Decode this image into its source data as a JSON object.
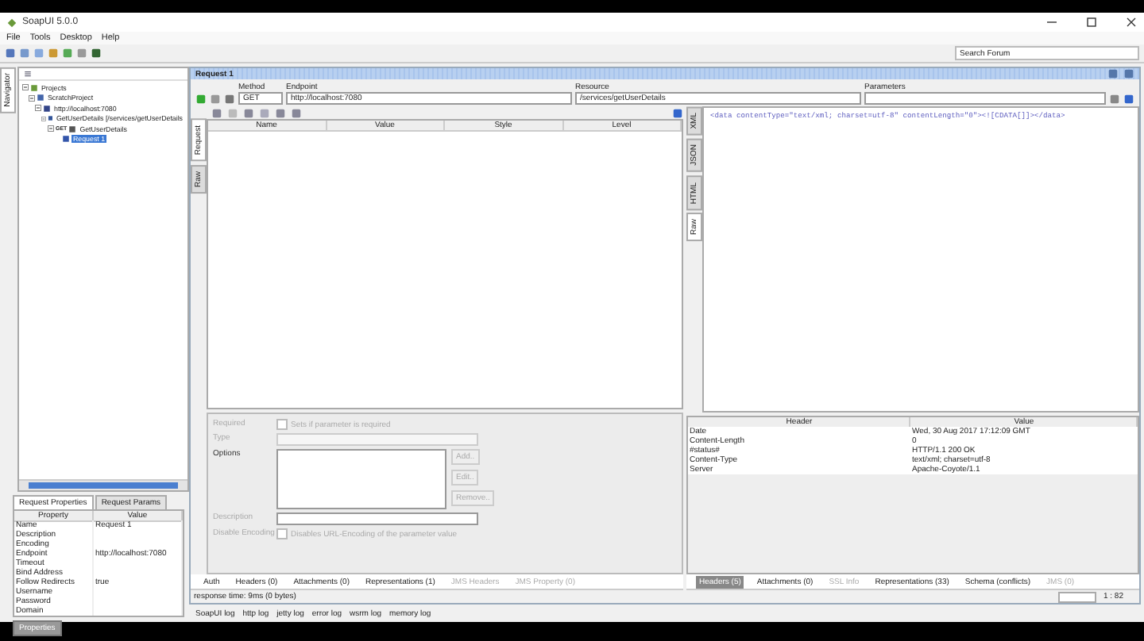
{
  "window": {
    "title": "SoapUI 5.0.0"
  },
  "menu": [
    "File",
    "Tools",
    "Desktop",
    "Help"
  ],
  "search": {
    "placeholder": "Search Forum"
  },
  "navigator": {
    "tab": "Navigator",
    "tree": [
      {
        "label": "Projects",
        "kind": "projects",
        "selected": false,
        "expanded": true,
        "children": [
          {
            "label": "ScratchProject",
            "kind": "project",
            "selected": false,
            "expanded": true,
            "children": [
              {
                "label": "http://localhost:7080",
                "kind": "endpoint",
                "selected": false,
                "expanded": true,
                "children": [
                  {
                    "label": "GetUserDetails [/services/getUserDetails",
                    "kind": "resource",
                    "selected": false,
                    "expanded": true,
                    "children": [
                      {
                        "label": "GetUserDetails",
                        "badge": "GET",
                        "kind": "method",
                        "selected": false,
                        "expanded": true,
                        "children": [
                          {
                            "label": "Request 1",
                            "kind": "request",
                            "selected": true
                          }
                        ]
                      }
                    ]
                  }
                ]
              }
            ]
          }
        ]
      }
    ]
  },
  "properties": {
    "tabs": [
      {
        "label": "Request Properties",
        "selected": true
      },
      {
        "label": "Request Params",
        "selected": false
      }
    ],
    "columns": [
      "Property",
      "Value"
    ],
    "rows": [
      {
        "property": "Name",
        "value": "Request 1"
      },
      {
        "property": "Description"
      },
      {
        "property": "Encoding"
      },
      {
        "property": "Endpoint",
        "value": "http://localhost:7080"
      },
      {
        "property": "Timeout"
      },
      {
        "property": "Bind Address"
      },
      {
        "property": "Follow Redirects",
        "value": "true"
      },
      {
        "property": "Username"
      },
      {
        "property": "Password"
      },
      {
        "property": "Domain"
      }
    ],
    "button": "Properties"
  },
  "request": {
    "title": "Request 1",
    "method": {
      "label": "Method",
      "value": "GET"
    },
    "endpoint": {
      "label": "Endpoint",
      "value": "http://localhost:7080"
    },
    "resource": {
      "label": "Resource",
      "value": "/services/getUserDetails"
    },
    "parameters": {
      "label": "Parameters"
    },
    "side_tabs": [
      {
        "label": "Request",
        "selected": true
      },
      {
        "label": "Raw",
        "selected": false
      }
    ],
    "columns": [
      "Name",
      "Value",
      "Style",
      "Level"
    ],
    "form": {
      "required": {
        "label": "Required",
        "text": "Sets if parameter is required",
        "checked": false
      },
      "type": {
        "label": "Type"
      },
      "options": {
        "label": "Options",
        "buttons": [
          "Add..",
          "Edit..",
          "Remove.."
        ]
      },
      "description": {
        "label": "Description"
      },
      "disable_encoding": {
        "label": "Disable Encoding",
        "text": "Disables URL-Encoding of the parameter value",
        "checked": false
      }
    },
    "tabs": [
      {
        "label": "Auth",
        "disabled": false
      },
      {
        "label": "Headers (0)",
        "disabled": false
      },
      {
        "label": "Attachments (0)",
        "disabled": false
      },
      {
        "label": "Representations (1)",
        "disabled": false
      },
      {
        "label": "JMS Headers",
        "disabled": true
      },
      {
        "label": "JMS Property (0)",
        "disabled": true
      }
    ],
    "status": "response time: 9ms (0 bytes)"
  },
  "response": {
    "side_tabs": [
      {
        "label": "XML",
        "selected": false
      },
      {
        "label": "JSON",
        "selected": false
      },
      {
        "label": "HTML",
        "selected": false
      },
      {
        "label": "Raw",
        "selected": true
      }
    ],
    "raw": "<data contentType=\"text/xml; charset=utf-8\" contentLength=\"0\"><![CDATA[]]></data>",
    "columns": [
      "Header",
      "Value"
    ],
    "rows": [
      {
        "header": "Date",
        "value": "Wed, 30 Aug 2017 17:12:09 GMT"
      },
      {
        "header": "Content-Length",
        "value": "0"
      },
      {
        "header": "#status#",
        "value": "HTTP/1.1 200 OK"
      },
      {
        "header": "Content-Type",
        "value": "text/xml; charset=utf-8"
      },
      {
        "header": "Server",
        "value": "Apache-Coyote/1.1"
      }
    ],
    "tabs": [
      {
        "label": "Headers (5)",
        "selected": true,
        "disabled": false
      },
      {
        "label": "Attachments (0)",
        "selected": false,
        "disabled": false
      },
      {
        "label": "SSL Info",
        "selected": false,
        "disabled": true
      },
      {
        "label": "Representations (33)",
        "selected": false,
        "disabled": false
      },
      {
        "label": "Schema (conflicts)",
        "selected": false,
        "disabled": false
      },
      {
        "label": "JMS (0)",
        "selected": false,
        "disabled": true
      }
    ],
    "position": "1 : 82"
  },
  "logs": [
    "SoapUI log",
    "http log",
    "jetty log",
    "error log",
    "wsrm log",
    "memory log"
  ]
}
